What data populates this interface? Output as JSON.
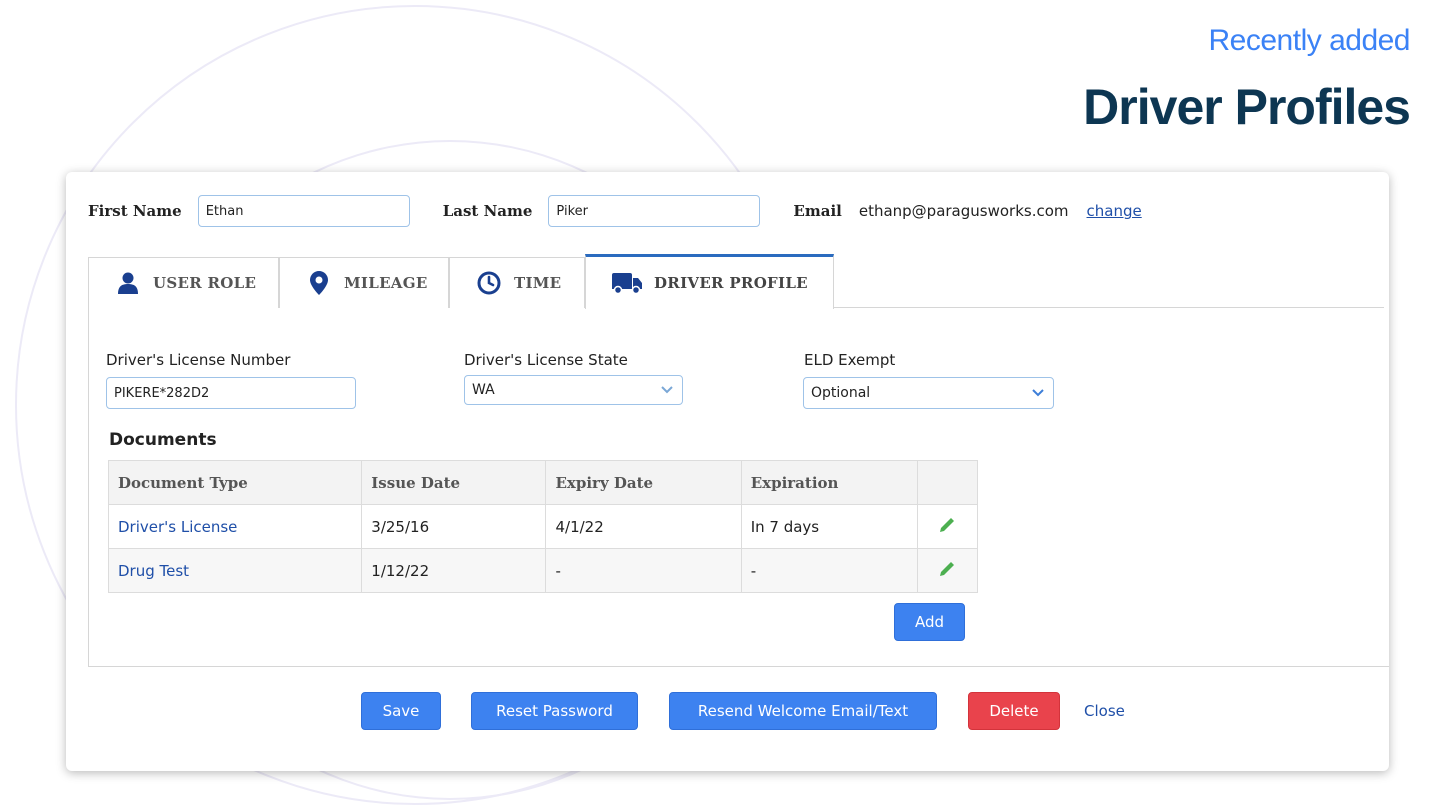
{
  "hero": {
    "subtitle": "Recently added",
    "title": "Driver Profiles"
  },
  "profile": {
    "first_name_label": "First Name",
    "first_name": "Ethan",
    "last_name_label": "Last Name",
    "last_name": "Piker",
    "email_label": "Email",
    "email": "ethanp@paragusworks.com",
    "email_change": "change"
  },
  "tabs": [
    {
      "label": "USER ROLE",
      "icon": "user-icon"
    },
    {
      "label": "MILEAGE",
      "icon": "map-pin-icon"
    },
    {
      "label": "TIME",
      "icon": "clock-icon"
    },
    {
      "label": "DRIVER PROFILE",
      "icon": "truck-icon",
      "active": true
    }
  ],
  "driver": {
    "license_number_label": "Driver's License Number",
    "license_number": "PIKERE*282D2",
    "license_state_label": "Driver's License State",
    "license_state": "WA",
    "eld_label": "ELD Exempt",
    "eld_value": "Optional"
  },
  "documents": {
    "title": "Documents",
    "columns": [
      "Document Type",
      "Issue Date",
      "Expiry Date",
      "Expiration"
    ],
    "rows": [
      {
        "type": "Driver's License",
        "issue": "3/25/16",
        "expiry": "4/1/22",
        "expiration": "In 7 days"
      },
      {
        "type": "Drug Test",
        "issue": "1/12/22",
        "expiry": "-",
        "expiration": "-"
      }
    ],
    "add_label": "Add"
  },
  "actions": {
    "save": "Save",
    "reset_password": "Reset Password",
    "resend": "Resend Welcome Email/Text",
    "delete": "Delete",
    "close": "Close"
  },
  "colors": {
    "primary_button": "#3d82f0",
    "danger_button": "#e9434c",
    "link": "#1f4fa8",
    "edit_icon": "#4caf50",
    "tab_icon": "#1a3f8f",
    "hero_title": "#0d3652",
    "hero_subtitle": "#3b82f6"
  }
}
